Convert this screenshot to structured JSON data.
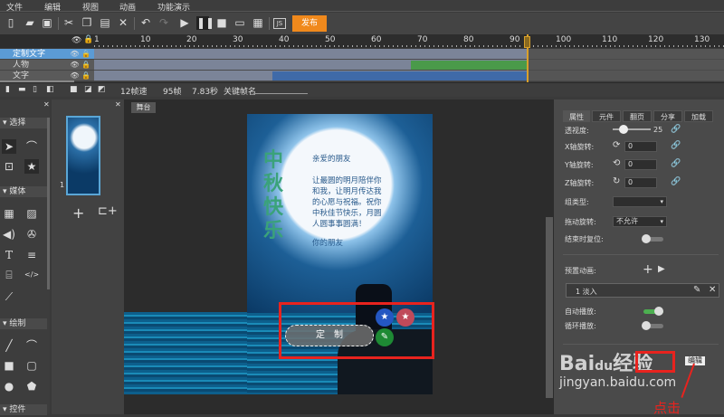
{
  "menu": [
    "文件",
    "编辑",
    "视图",
    "动画",
    "功能演示"
  ],
  "toolbar": {
    "publish_label": "发布",
    "js_label": "JS"
  },
  "timeline": {
    "ticks": [
      "1",
      "10",
      "20",
      "30",
      "40",
      "50",
      "60",
      "70",
      "80",
      "90",
      "100",
      "110",
      "120",
      "130"
    ],
    "layers": [
      {
        "name": "定制文字",
        "selected": true
      },
      {
        "name": "人物"
      },
      {
        "name": "文字"
      }
    ],
    "current_frame": 95,
    "fps": "12帧速",
    "frames": "95帧",
    "duration": "7.83秒",
    "keyframe_label": "关键帧名"
  },
  "left_panel": {
    "sections": [
      "选择",
      "媒体",
      "绘制",
      "控件"
    ]
  },
  "pages": {
    "page_number": "1"
  },
  "stage": {
    "tab": "舞台",
    "card": {
      "greeting": "亲爱的朋友",
      "body": [
        "让最圆的明月陪伴你",
        "和我，让明月传达我",
        "的心愿与祝福。祝你",
        "中秋佳节快乐，月圆",
        "人圆事事圆满！"
      ],
      "sign": "你的朋友",
      "title_art": "中秋快乐",
      "button": "定　制"
    }
  },
  "props": {
    "tabs": [
      "属性",
      "元件",
      "翻页",
      "分享",
      "加载"
    ],
    "perspective_label": "透视度:",
    "perspective_value": "25",
    "x_rot_label": "X轴旋转:",
    "x_rot": "0",
    "y_rot_label": "Y轴旋转:",
    "y_rot": "0",
    "z_rot_label": "Z轴旋转:",
    "z_rot": "0",
    "group_type_label": "组类型:",
    "group_type": "",
    "drag_label": "拖动旋转:",
    "drag_value": "不允许",
    "reset_label": "结束时复位:",
    "preset_label": "预置动画:",
    "anim_item": "1  淡入",
    "autoplay_label": "自动播放:",
    "autoplay": true,
    "loop_label": "循环播放:",
    "loop": false,
    "edit_button": "编辑"
  },
  "annotation": {
    "click_text": "点击",
    "watermark": "Baidu经验 jingyan.baidu.com"
  },
  "colors": {
    "accent": "#f0891c",
    "selected_layer": "#5b9bd5",
    "green_track": "#4a9a4a",
    "blue_track": "#3f6aa8",
    "highlight": "#e8231e"
  }
}
